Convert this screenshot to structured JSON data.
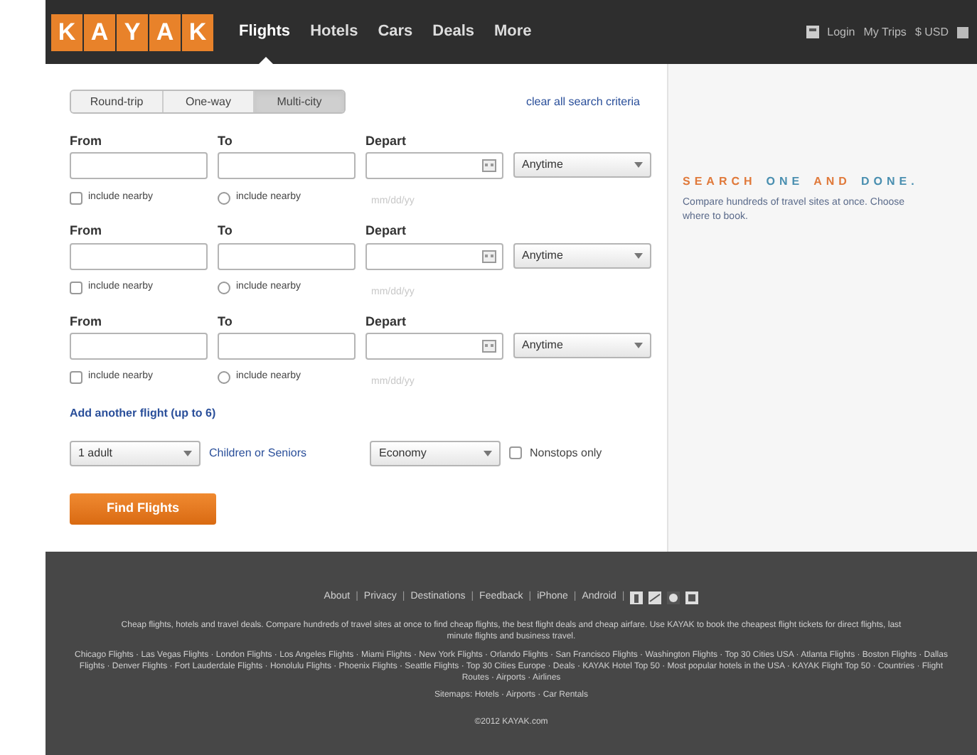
{
  "header": {
    "logo_letters": [
      "K",
      "A",
      "Y",
      "A",
      "K"
    ],
    "nav": [
      {
        "label": "Flights",
        "selected": true
      },
      {
        "label": "Hotels",
        "selected": false
      },
      {
        "label": "Cars",
        "selected": false
      },
      {
        "label": "Deals",
        "selected": false
      },
      {
        "label": "More",
        "selected": false
      }
    ],
    "account": [
      "Login",
      "My Trips",
      "$ USD"
    ]
  },
  "search": {
    "trip_types": [
      {
        "label": "Round-trip",
        "selected": false
      },
      {
        "label": "One-way",
        "selected": false
      },
      {
        "label": "Multi-city",
        "selected": true
      }
    ],
    "clear_link": "clear all search criteria",
    "legs": [
      {
        "from_label": "From",
        "to_label": "To",
        "depart_label": "Depart",
        "time": "Anytime",
        "from_nearby_label": "include nearby",
        "to_nearby_label": "include nearby",
        "from_nearby": false,
        "to_nearby": false,
        "hint": "mm/dd/yy"
      },
      {
        "from_label": "From",
        "to_label": "To",
        "depart_label": "Depart",
        "time": "Anytime",
        "from_nearby_label": "include nearby",
        "to_nearby_label": "include nearby",
        "from_nearby": false,
        "to_nearby": false,
        "hint": "mm/dd/yy"
      },
      {
        "from_label": "From",
        "to_label": "To",
        "depart_label": "Depart",
        "time": "Anytime",
        "from_nearby_label": "include nearby",
        "to_nearby_label": "include nearby",
        "from_nearby": false,
        "to_nearby": false,
        "hint": "mm/dd/yy"
      }
    ],
    "add_flight_link": "Add another flight (up to 6)",
    "travelers": "1 adult",
    "children_link": "Children or Seniors",
    "cabin": "Economy",
    "nonstop": {
      "label": "Nonstops only",
      "checked": false
    },
    "submit": "Find Flights"
  },
  "promo": {
    "title_words": [
      {
        "text": "SEARCH",
        "color": "#e0793a"
      },
      {
        "text": "ONE",
        "color": "#4a8fb0"
      },
      {
        "text": "AND",
        "color": "#e0793a"
      },
      {
        "text": "DONE.",
        "color": "#4a8fb0"
      }
    ],
    "description": "Compare hundreds of travel sites at once. Choose where to book."
  },
  "footer": {
    "links": [
      "About",
      "Privacy",
      "Destinations",
      "Feedback",
      "iPhone",
      "Android"
    ],
    "separator": "|",
    "about": "Cheap flights, hotels and travel deals. Compare hundreds of travel sites at once to find cheap flights, the best flight deals and cheap airfare. Use KAYAK to book the cheapest flight tickets for direct flights, last minute flights and business travel.",
    "city_links": "Chicago Flights · Las Vegas Flights · London Flights · Los Angeles Flights · Miami Flights · New York Flights · Orlando Flights · San Francisco Flights · Washington Flights · Top 30 Cities USA · Atlanta Flights · Boston Flights · Dallas Flights · Denver Flights · Fort Lauderdale Flights · Honolulu Flights · Phoenix Flights · Seattle Flights · Top 30 Cities Europe · Deals · KAYAK Hotel Top 50 · Most popular hotels in the USA · KAYAK Flight Top 50 · Countries · Flight Routes · Airports · Airlines",
    "sitemap_links": "Sitemaps: Hotels · Airports · Car Rentals",
    "copyright": "©2012 KAYAK.com"
  }
}
